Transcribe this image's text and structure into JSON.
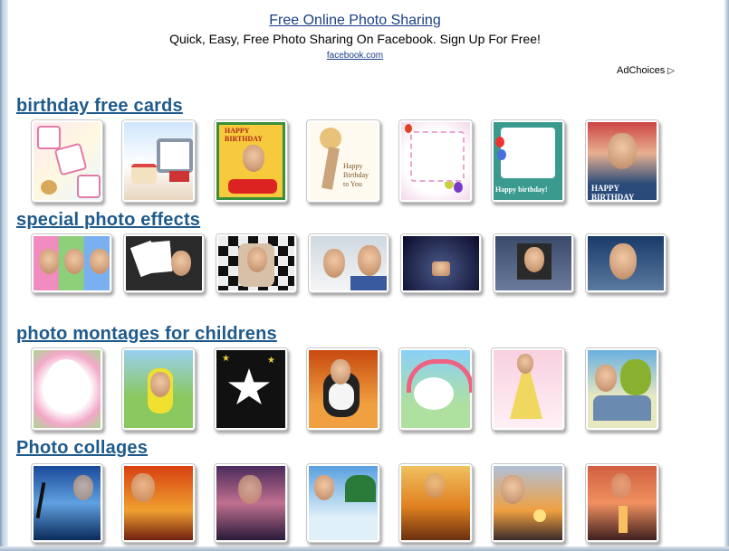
{
  "ad": {
    "title": "Free Online Photo Sharing",
    "description": "Quick, Easy, Free Photo Sharing On Facebook. Sign Up For Free!",
    "url": "facebook.com",
    "adchoices": "AdChoices",
    "adchoices_icon": "play-triangle-icon"
  },
  "sections": {
    "birthday": {
      "title": "birthday free cards"
    },
    "effects": {
      "title": "special photo effects"
    },
    "children": {
      "title": "photo montages for childrens"
    },
    "collages": {
      "title": "Photo collages"
    }
  },
  "thumb_text": {
    "happy_birthday": "HAPPY BIRTHDAY",
    "happy_birthday_to_you": "Happy Birthday to You",
    "happy_birthday_small": "Happy birthday!"
  },
  "colors": {
    "link": "#1a3e86",
    "section_title": "#1f5a8c",
    "frame": "#7f9db9"
  }
}
